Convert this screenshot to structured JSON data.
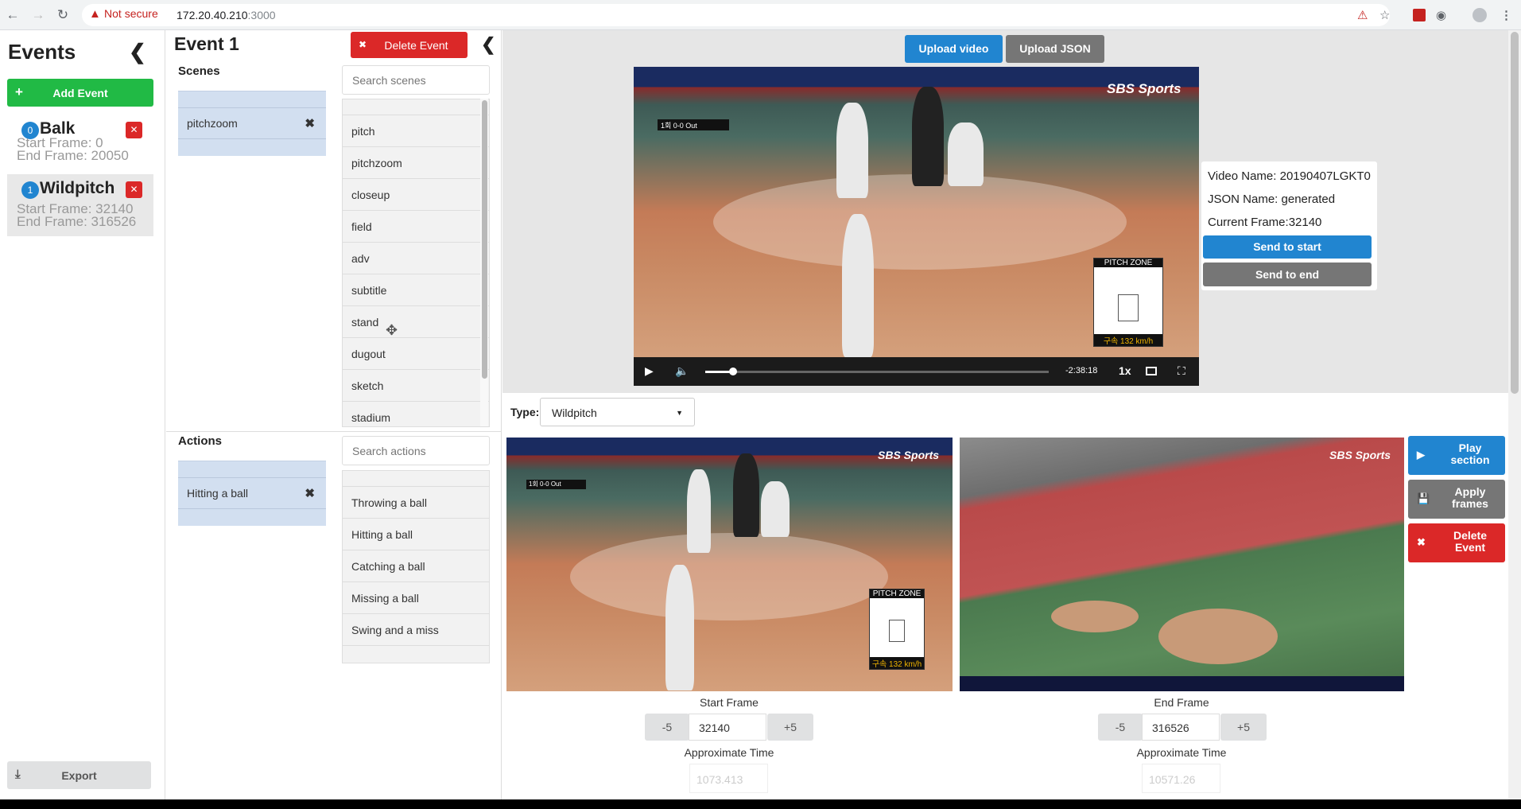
{
  "browser": {
    "back_icon": "arrow-left-icon",
    "forward_icon": "arrow-right-icon",
    "reload_icon": "reload-icon",
    "security_label": "Not secure",
    "url_host": "172.20.40.210",
    "url_port": ":3000"
  },
  "events_panel": {
    "title": "Events",
    "add_label": "Add Event",
    "items": [
      {
        "index": "0",
        "name": "Balk",
        "start": "Start Frame: 0",
        "end": "End Frame: 20050"
      },
      {
        "index": "1",
        "name": "Wildpitch",
        "start": "Start Frame: 32140",
        "end": "End Frame: 316526"
      }
    ],
    "export_label": "Export"
  },
  "event_editor": {
    "title": "Event 1",
    "delete_label": "Delete Event",
    "scenes": {
      "title": "Scenes",
      "selected": "pitchzoom",
      "search_placeholder": "Search scenes",
      "options": [
        "pitch",
        "pitchzoom",
        "closeup",
        "field",
        "adv",
        "subtitle",
        "stand",
        "dugout",
        "sketch",
        "stadium"
      ]
    },
    "actions": {
      "title": "Actions",
      "selected": "Hitting a ball",
      "search_placeholder": "Search actions",
      "options": [
        "Throwing a ball",
        "Hitting a ball",
        "Catching a ball",
        "Missing a ball",
        "Swing and a miss"
      ]
    }
  },
  "video": {
    "upload_video_label": "Upload video",
    "upload_json_label": "Upload JSON",
    "time_remaining": "-2:38:18",
    "speed": "1x",
    "progress_fraction": 0.08,
    "broadcaster": "SBS Sports",
    "pitch_zone_label": "PITCH ZONE",
    "speed_readout": "구속 132 km/h",
    "score": "1회 0-0 Out"
  },
  "info": {
    "video_name": "Video Name: 20190407LGKT0",
    "json_name": "JSON Name: generated",
    "current_frame": "Current Frame:32140",
    "send_start_label": "Send to start",
    "send_end_label": "Send to end"
  },
  "type_field": {
    "label": "Type:",
    "value": "Wildpitch"
  },
  "frames": {
    "start": {
      "label": "Start Frame",
      "minus": "-5",
      "value": "32140",
      "plus": "+5",
      "approx_label": "Approximate Time",
      "approx_value": "1073.413"
    },
    "end": {
      "label": "End Frame",
      "minus": "-5",
      "value": "316526",
      "plus": "+5",
      "approx_label": "Approximate Time",
      "approx_value": "10571.26"
    }
  },
  "section_actions": {
    "play_label": "Play section",
    "apply_label": "Apply frames",
    "delete_label": "Delete Event"
  },
  "colors": {
    "primary": "#2185d0",
    "success": "#21ba45",
    "danger": "#db2828",
    "secondary": "#767676"
  }
}
